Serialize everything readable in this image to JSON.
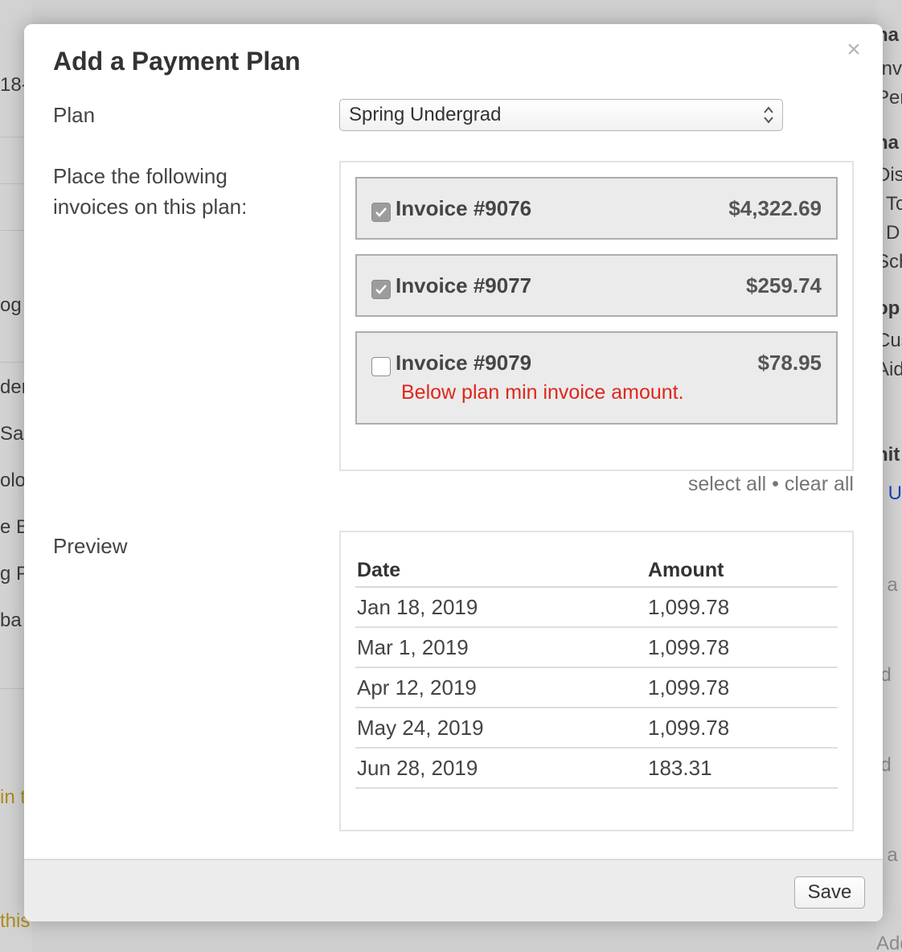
{
  "background": {
    "left_fragments": [
      "18-",
      "og (",
      "der",
      "Sal",
      "olo",
      "e B",
      "g P",
      "ba",
      "in t",
      "this term."
    ],
    "right_fragments": [
      "ha",
      "Inv",
      "Per",
      "na",
      "Dis",
      "To",
      "D",
      "Sch",
      "op",
      "Cus",
      "Aid",
      "nit",
      "r U",
      "t a",
      "ld",
      "ld",
      "t a",
      "Add"
    ]
  },
  "modal": {
    "title": "Add a Payment Plan",
    "close_symbol": "×",
    "plan": {
      "label": "Plan",
      "selected": "Spring Undergrad"
    },
    "invoices": {
      "label": "Place the following invoices on this plan:",
      "items": [
        {
          "name": "Invoice #9076",
          "amount": "$4,322.69",
          "checked": true,
          "error": ""
        },
        {
          "name": "Invoice #9077",
          "amount": "$259.74",
          "checked": true,
          "error": ""
        },
        {
          "name": "Invoice #9079",
          "amount": "$78.95",
          "checked": false,
          "error": "Below plan min invoice amount."
        }
      ],
      "select_all": "select all",
      "separator": "•",
      "clear_all": "clear all"
    },
    "preview": {
      "label": "Preview",
      "columns": [
        "Date",
        "Amount"
      ],
      "rows": [
        [
          "Jan 18, 2019",
          "1,099.78"
        ],
        [
          "Mar 1, 2019",
          "1,099.78"
        ],
        [
          "Apr 12, 2019",
          "1,099.78"
        ],
        [
          "May 24, 2019",
          "1,099.78"
        ],
        [
          "Jun 28, 2019",
          "183.31"
        ]
      ]
    },
    "footer": {
      "save_label": "Save"
    }
  },
  "colors": {
    "error": "#e0261b",
    "checkbox_checked": "#9c9c9c",
    "footer_bg": "#ececec"
  }
}
